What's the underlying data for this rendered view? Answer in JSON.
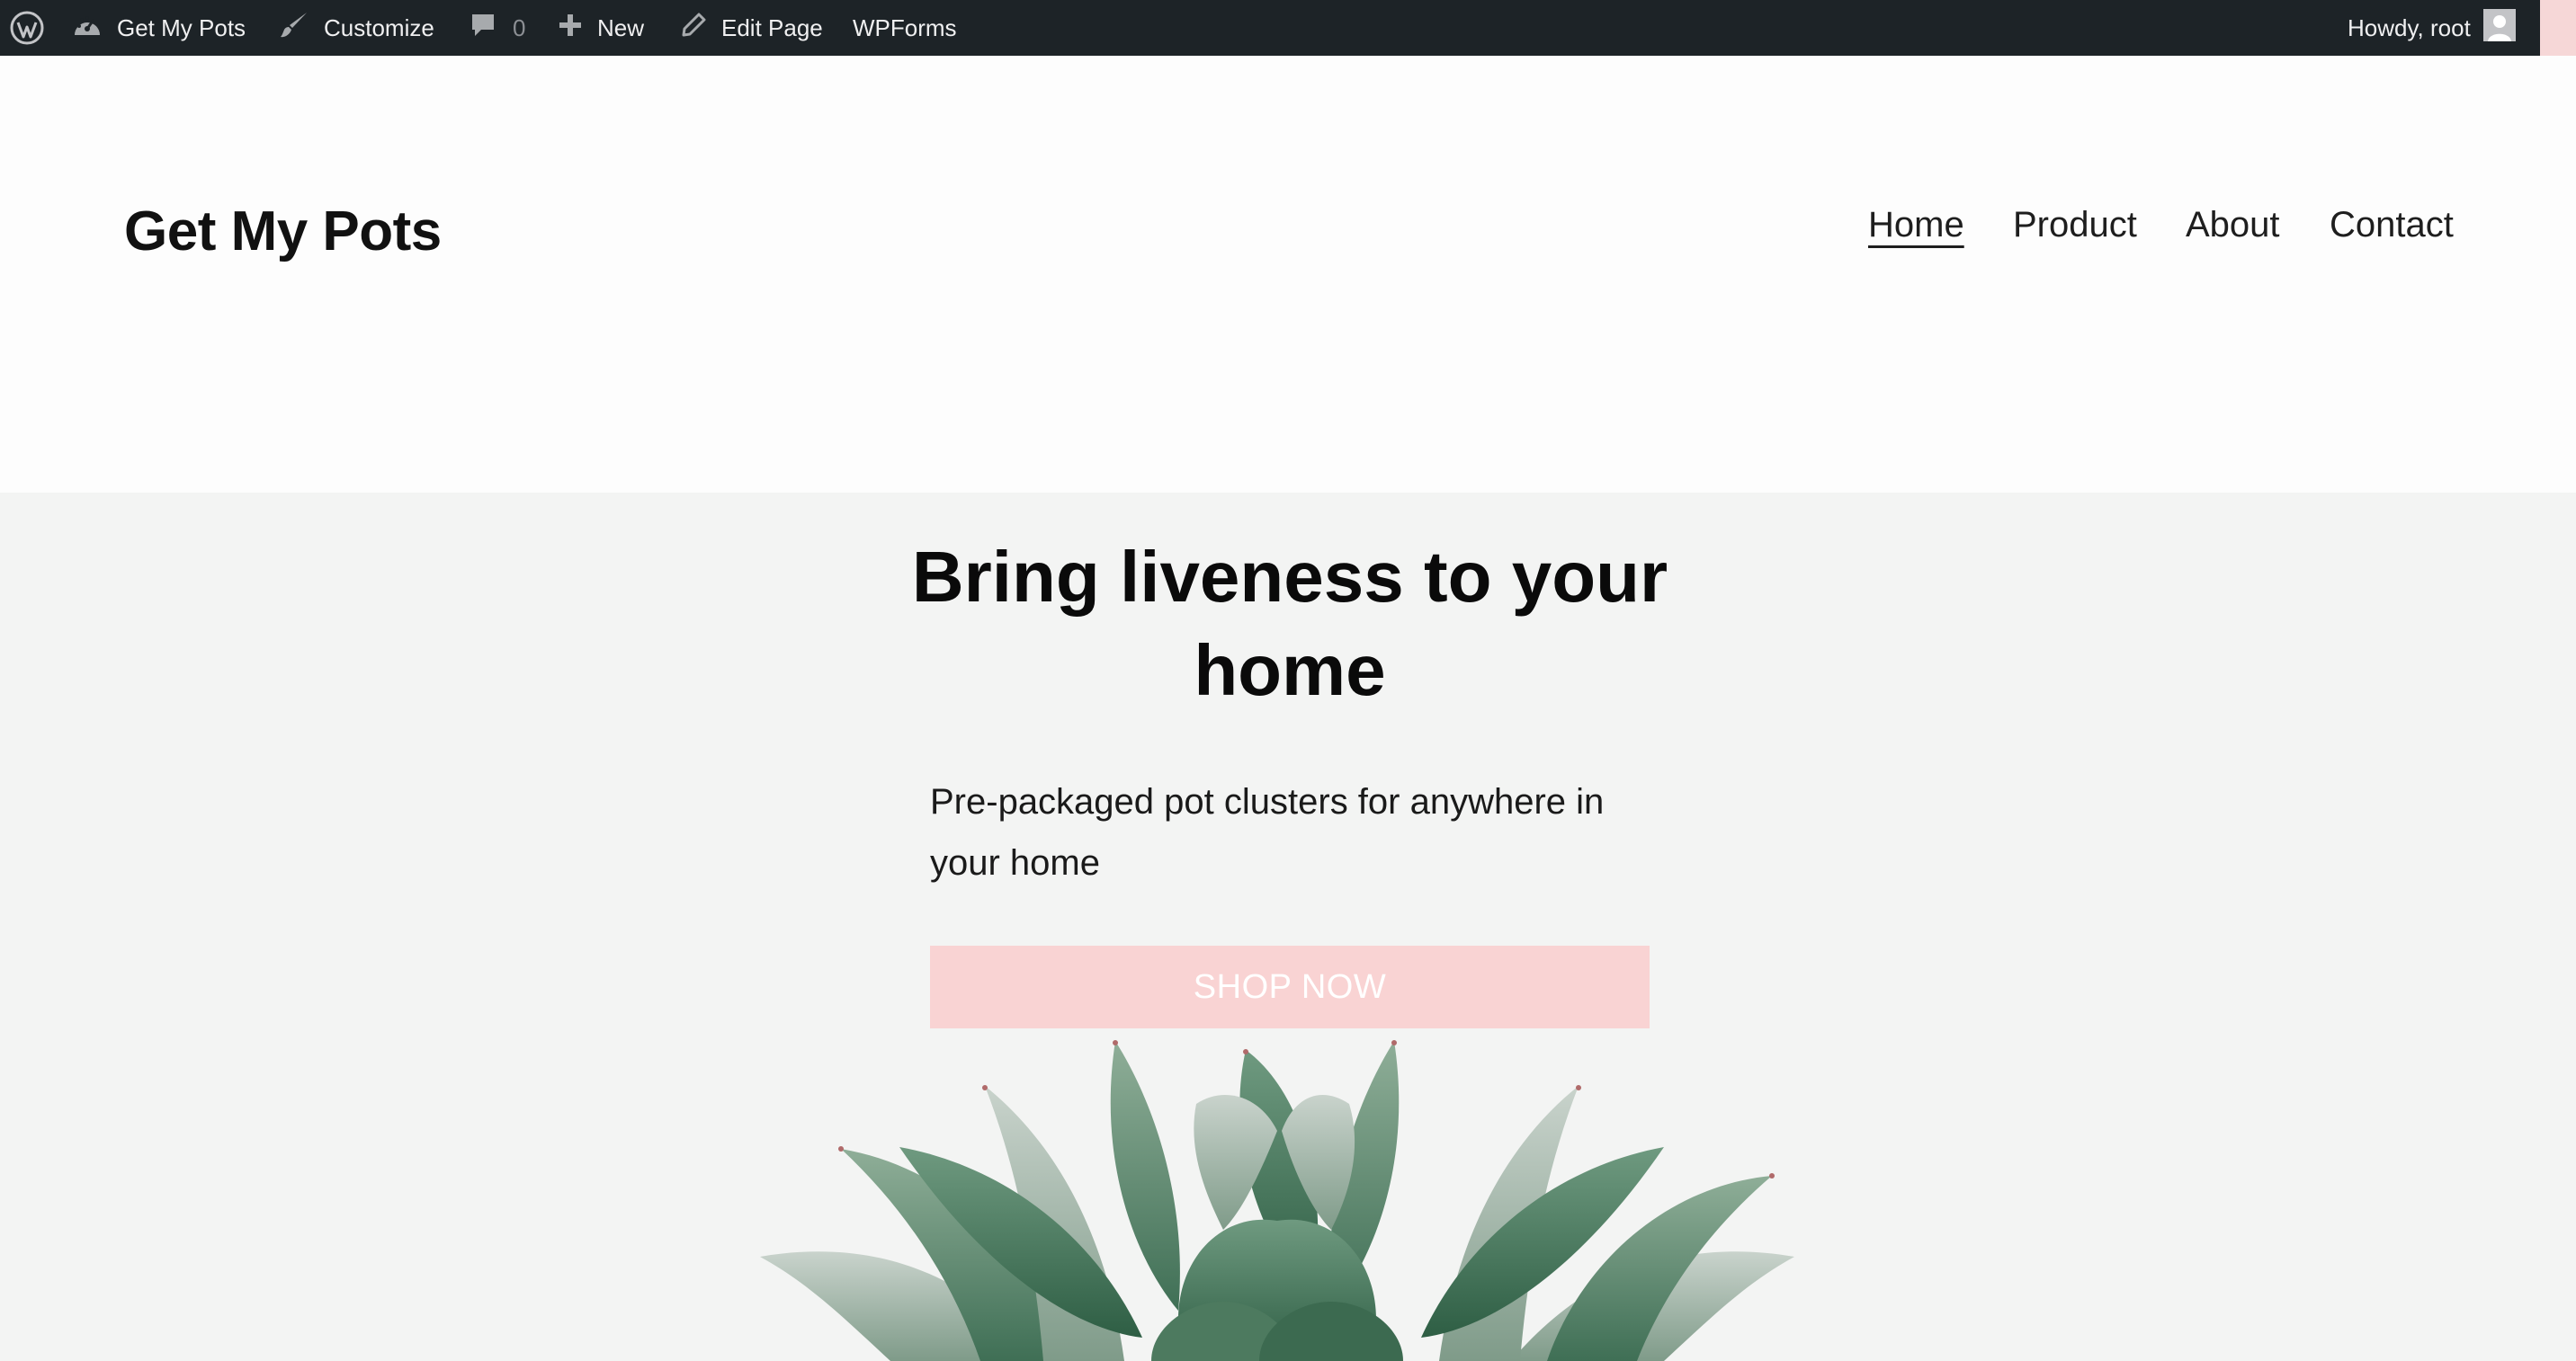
{
  "admin_bar": {
    "site_name": "Get My Pots",
    "customize": "Customize",
    "comments_count": "0",
    "new": "New",
    "edit_page": "Edit Page",
    "wpforms": "WPForms",
    "greeting": "Howdy, root",
    "icons": [
      "wordpress-logo",
      "dashboard-gauge",
      "paintbrush",
      "comment-bubble",
      "plus",
      "pencil",
      "user-avatar"
    ]
  },
  "header": {
    "site_title": "Get My Pots",
    "nav": [
      {
        "label": "Home",
        "active": true
      },
      {
        "label": "Product",
        "active": false
      },
      {
        "label": "About",
        "active": false
      },
      {
        "label": "Contact",
        "active": false
      }
    ]
  },
  "hero": {
    "title_line1": "Bring liveness to your",
    "title_line2": "home",
    "subtitle_line1": "Pre-packaged pot clusters for anywhere in",
    "subtitle_line2": "your home",
    "button": "SHOP NOW",
    "image": "succulent-plant"
  },
  "colors": {
    "admin_bar_bg": "#1d2327",
    "button_bg": "#f9d3d3",
    "hero_bg": "#f3f4f3",
    "page_bg": "#fdfdfd"
  }
}
